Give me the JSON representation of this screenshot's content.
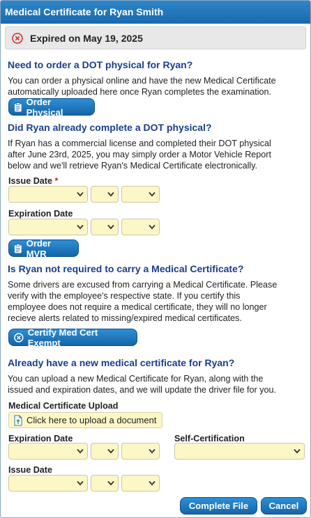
{
  "dialog": {
    "title": "Medical Certificate for Ryan Smith"
  },
  "status": {
    "text": "Expired on May 19, 2025"
  },
  "order_physical": {
    "heading": "Need to order a DOT physical for Ryan?",
    "text_line1": "You can order a physical online and have the new Medical Certificate",
    "text_line2": "automatically uploaded here once Ryan completes the examination.",
    "button": "Order Physical"
  },
  "completed_physical": {
    "heading": "Did Ryan already complete a DOT physical?",
    "text_line1": "If Ryan has a commercial license and completed their DOT physical",
    "text_line2": "after June 23rd, 2025, you may simply order a Motor Vehicle Report",
    "text_line3": "below and we'll retrieve Ryan's Medical Certificate electronically.",
    "issue_date_label": "Issue Date",
    "required_mark": "*",
    "expiration_date_label": "Expiration Date",
    "button": "Order MVR"
  },
  "not_required": {
    "heading": "Is Ryan not required to carry a Medical Certificate?",
    "text_line1": "Some drivers are excused from carrying a Medical Certificate. Please",
    "text_line2": "verify with the employee's respective state. If you certify this",
    "text_line3": "employee does not require a medical certificate, they will no longer",
    "text_line4": "recieve alerts related to missing/expired medical certificates.",
    "button": "Certify Med Cert Exempt"
  },
  "upload_section": {
    "heading": "Already have a new medical certificate for Ryan?",
    "text_line1": "You can upload a new Medical Certificate for Ryan, along with the",
    "text_line2": "issued and expiration dates, and we will update the driver file for you.",
    "upload_label": "Medical Certificate Upload",
    "upload_button": "Click here to upload a document",
    "expiration_date_label": "Expiration Date",
    "self_cert_label": "Self-Certification",
    "issue_date_label": "Issue Date"
  },
  "footer": {
    "complete_button": "Complete File",
    "cancel_button": "Cancel"
  },
  "colors": {
    "title_bar": "#1f75bb",
    "heading": "#1a3e8c",
    "button": "#1a72b8",
    "select_bg": "#fdf7c8",
    "expired_icon": "#d32f2f"
  },
  "icons": {
    "status": "error-x-circle-icon",
    "order_physical": "clipboard-icon",
    "order_mvr": "clipboard-icon",
    "exempt": "x-circle-icon",
    "upload": "document-upload-icon",
    "select": "chevron-down-icon"
  }
}
